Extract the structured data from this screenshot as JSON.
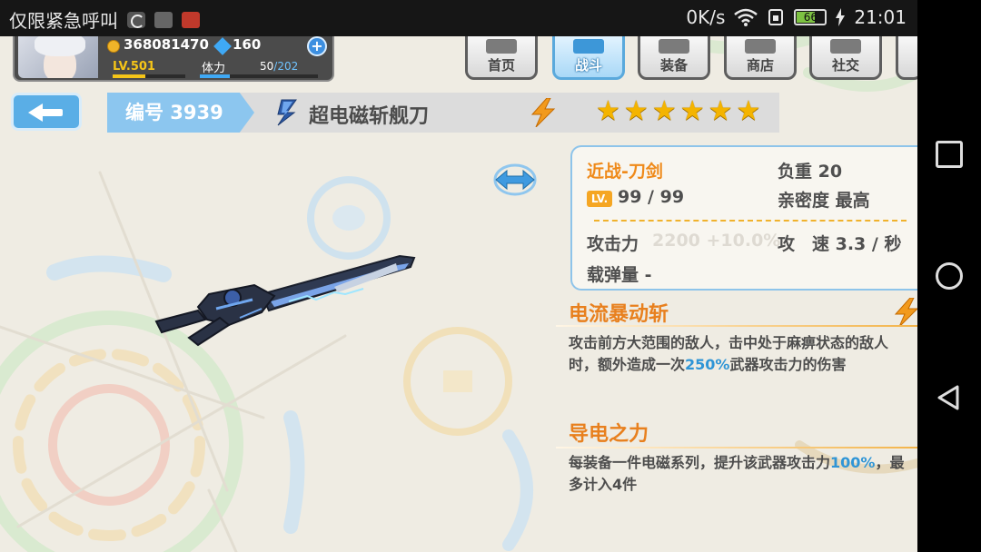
{
  "status_bar": {
    "app_name": "仅限紧急呼叫",
    "net_speed": "0K/s",
    "battery": "66",
    "time": "21:01",
    "icons": [
      "moon-icon",
      "gallery-icon",
      "video-icon",
      "wifi-icon",
      "sim-icon",
      "battery-icon",
      "charging-icon"
    ]
  },
  "player": {
    "gold": "368081470",
    "gems": "160",
    "level": "LV.501",
    "level_progress": 0.45,
    "stamina_label": "体力",
    "stamina_current": "50",
    "stamina_max": "/202",
    "stamina_progress": 0.25
  },
  "menu": [
    {
      "label": "首页",
      "icon": "home-icon",
      "active": false
    },
    {
      "label": "战斗",
      "icon": "battle-icon",
      "active": true
    },
    {
      "label": "装备",
      "icon": "equipment-icon",
      "active": false
    },
    {
      "label": "商店",
      "icon": "shop-icon",
      "active": false
    },
    {
      "label": "社交",
      "icon": "social-icon",
      "active": false
    }
  ],
  "weapon": {
    "id_label": "编号 3939",
    "name": "超电磁斩舰刀",
    "stars": 6,
    "type": "近战-刀剑",
    "weight": "负重 20",
    "level_badge": "LV.",
    "level": "99 / 99",
    "affinity": "亲密度 最高",
    "attack_label": "攻击力",
    "attack_value": "2200 +10.0%",
    "speed": "攻　速 3.3 / 秒",
    "ammo": "载弹量 -"
  },
  "skills": [
    {
      "title": "电流暴动斩",
      "desc_before": "攻击前方大范围的敌人，击中处于麻痹状态的敌人时，额外造成一次",
      "desc_highlight": "250%",
      "desc_after": "武器攻击力的伤害"
    },
    {
      "title": "导电之力",
      "desc_before": "每装备一件电磁系列，提升该武器攻击力",
      "desc_highlight": "100%",
      "desc_after": "，最多计入4件"
    }
  ],
  "colors": {
    "background": "#efece3",
    "accent_blue": "#5aaee6",
    "accent_orange": "#e8801e",
    "highlight_blue": "#2f95d6",
    "star_gold": "#f4b400"
  }
}
